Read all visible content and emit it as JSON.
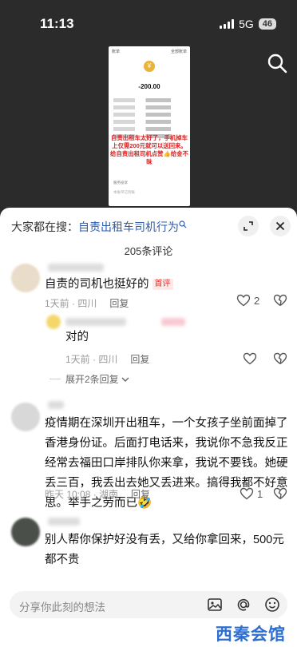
{
  "status_bar": {
    "time": "11:13",
    "network": "5G",
    "battery": "46"
  },
  "thumbnail": {
    "header_left": "账单",
    "header_right": "全部账单",
    "amount": "-200.00",
    "overlay_text": "自责出租车太好了，手机掉车上仅需200元就可以送回来。给自责出租司机点赞👍给金不昧",
    "footer_1": "服务投诉",
    "footer_2": "本账单已到账"
  },
  "related_search": {
    "prefix": "大家都在搜：",
    "keyword": "自责出租车司机行为"
  },
  "comment_count": "205条评论",
  "comments": [
    {
      "text": "自责的司机也挺好的",
      "tag": "首评",
      "meta": "1天前 · 四川",
      "reply": "回复",
      "likes": "2"
    },
    {
      "text": "对的",
      "meta": "1天前 · 四川",
      "reply": "回复"
    },
    {
      "expand": "展开2条回复"
    },
    {
      "text": "疫情期在深圳开出租车，一个女孩子坐前面掉了香港身份证。后面打电话来，我说你不急我反正经常去福田口岸排队你来拿，我说不要钱。她硬丢三百，我丢出去她又丢进来。搞得我都不好意思。举手之劳而已🤣",
      "meta": "昨天 10:08 · 湖南",
      "reply": "回复",
      "likes": "1"
    },
    {
      "text": "别人帮你保护好没有丢，又给你拿回来，500元都不贵"
    }
  ],
  "input": {
    "placeholder": "分享你此刻的想法"
  },
  "watermark": "西秦会馆",
  "colors": {
    "accent_blue": "#2a5db0",
    "tag_red": "#e8312b",
    "overlay_red": "#e02020"
  }
}
